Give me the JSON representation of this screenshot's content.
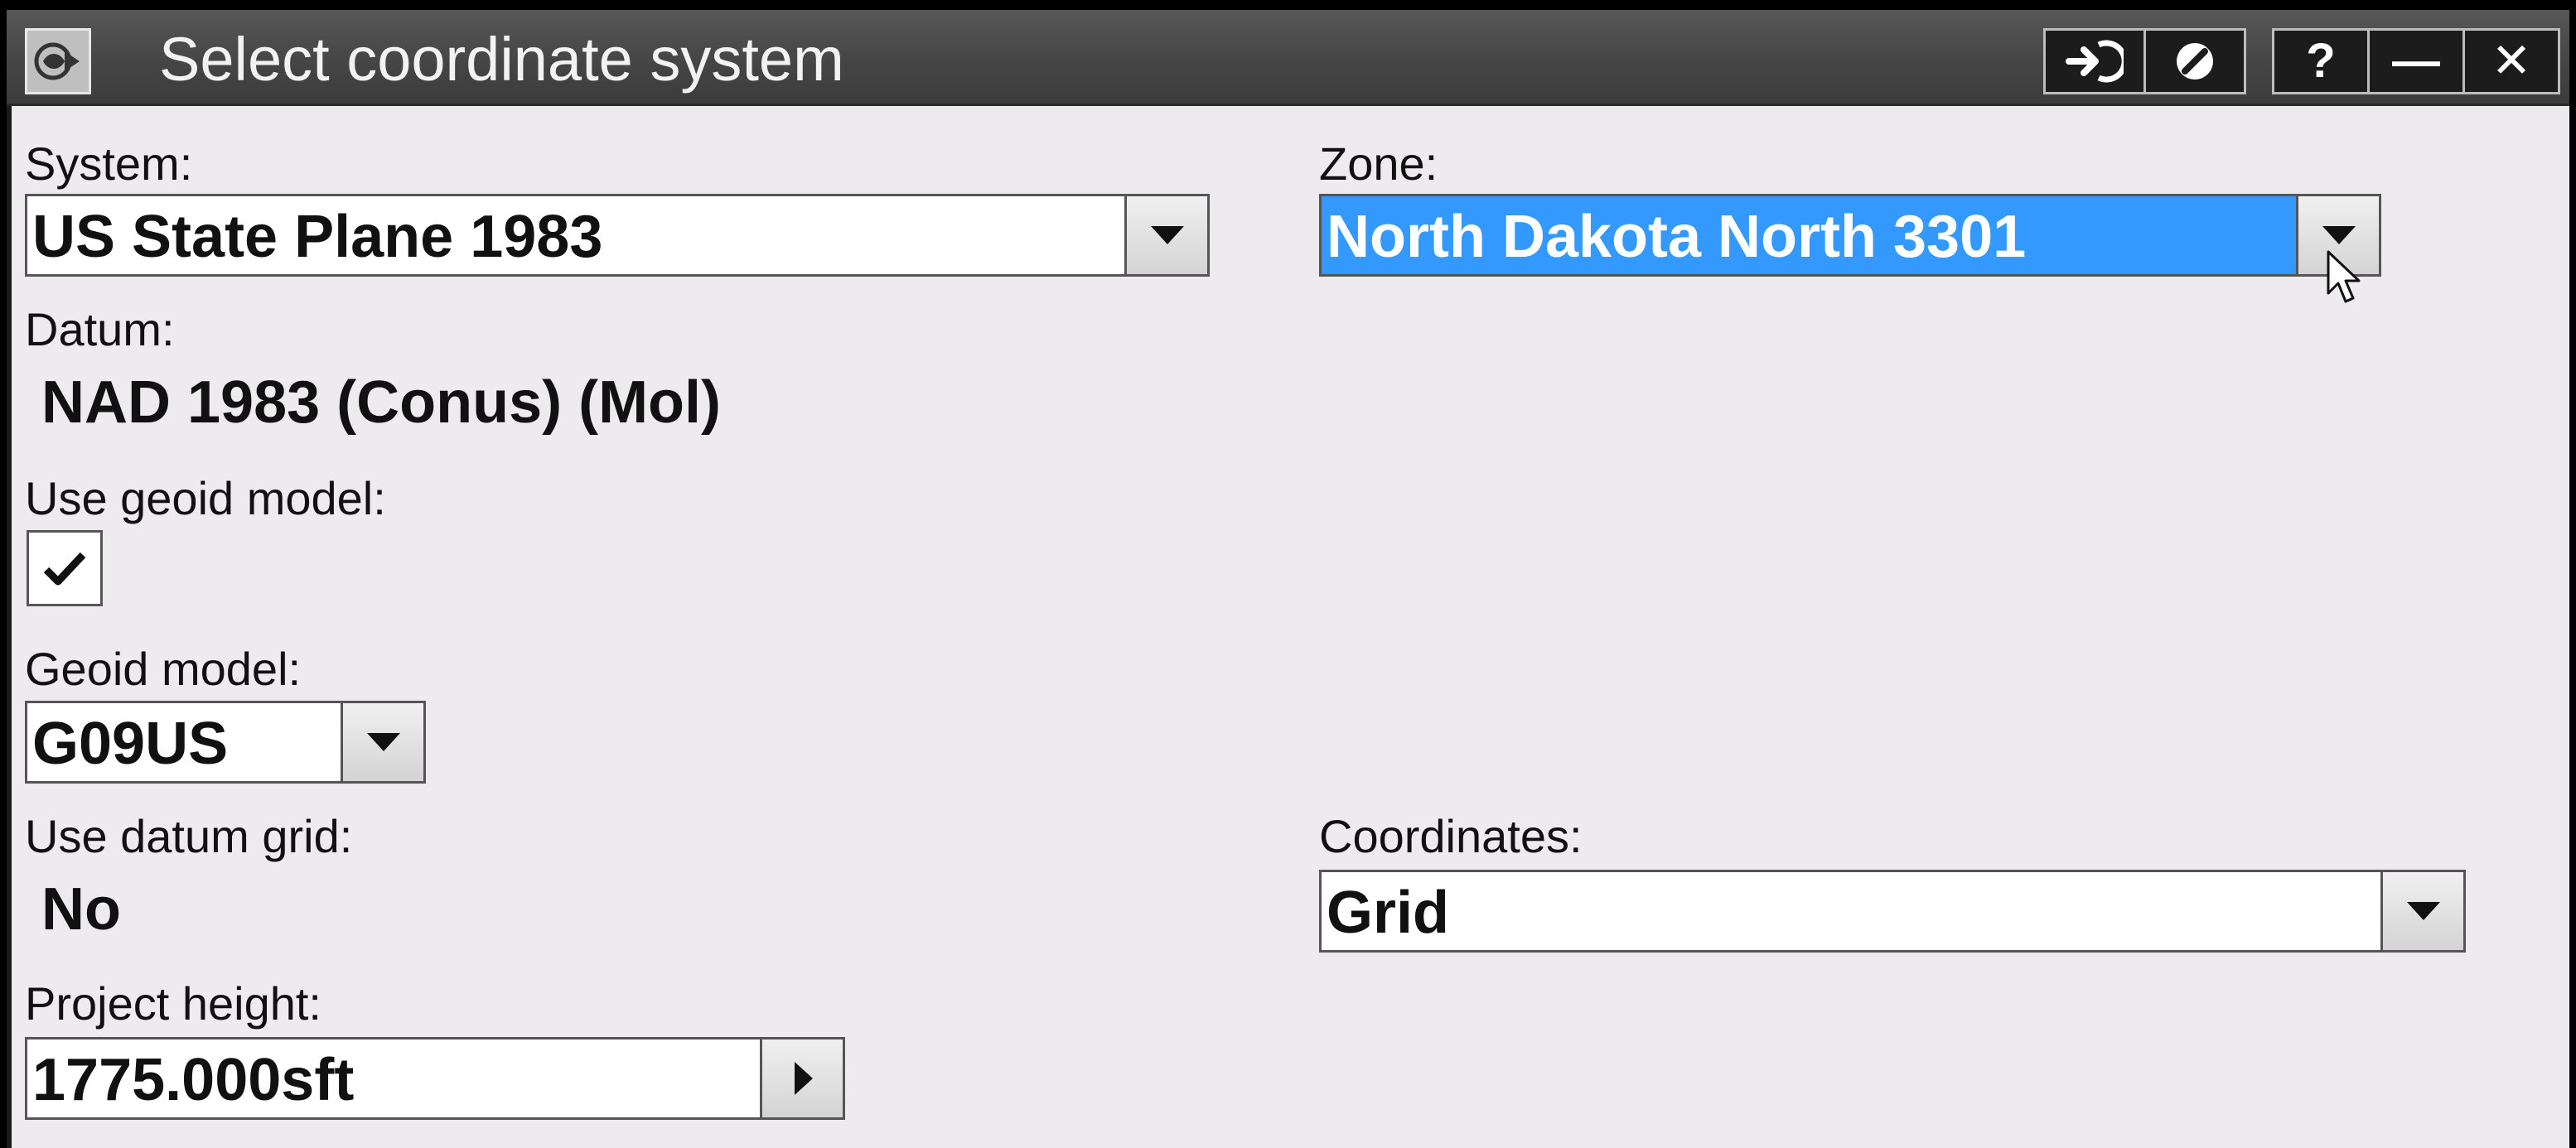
{
  "window": {
    "title": "Select coordinate system",
    "buttons": {
      "accept_icon": "arrow-enter-icon",
      "cancel_icon": "no-entry-icon",
      "help_label": "?",
      "minimize_label": "—",
      "close_label": "✕"
    }
  },
  "form": {
    "system": {
      "label": "System:",
      "value": "US State Plane 1983"
    },
    "zone": {
      "label": "Zone:",
      "value": "North Dakota North 3301"
    },
    "datum": {
      "label": "Datum:",
      "value": "NAD 1983 (Conus) (Mol)"
    },
    "use_geoid_model": {
      "label": "Use geoid model:",
      "checked": true
    },
    "geoid_model": {
      "label": "Geoid model:",
      "value": "G09US"
    },
    "use_datum_grid": {
      "label": "Use datum grid:",
      "value": "No"
    },
    "coordinates": {
      "label": "Coordinates:",
      "value": "Grid"
    },
    "project_height": {
      "label": "Project height:",
      "value": "1775.000sft"
    }
  },
  "colors": {
    "selection": "#3399ff",
    "titlebar": "#4a4a4a",
    "background": "#edebee"
  }
}
